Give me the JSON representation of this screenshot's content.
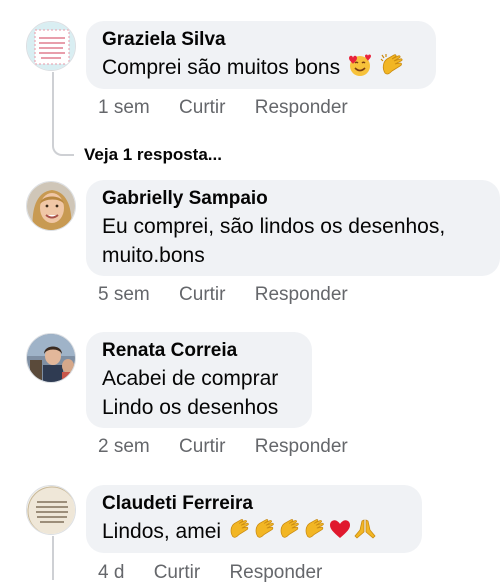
{
  "comments": [
    {
      "author": "Graziela Silva",
      "lines": [
        "Comprei são muitos bons"
      ],
      "emojis": [
        "smiling-face-with-hearts",
        "clapping-hands"
      ],
      "time": "1 sem",
      "like": "Curtir",
      "reply": "Responder"
    },
    {
      "author": "Gabrielly Sampaio",
      "lines": [
        "Eu comprei, são lindos os desenhos,",
        "muito.bons"
      ],
      "time": "5 sem",
      "like": "Curtir",
      "reply": "Responder"
    },
    {
      "author": "Renata Correia",
      "lines": [
        "Acabei de comprar",
        "Lindo os desenhos"
      ],
      "time": "2 sem",
      "like": "Curtir",
      "reply": "Responder"
    },
    {
      "author": "Claudeti Ferreira",
      "lines": [
        "Lindos, amei"
      ],
      "emojis": [
        "clapping-hands",
        "clapping-hands",
        "clapping-hands",
        "clapping-hands",
        "red-heart",
        "folded-hands"
      ],
      "time": "4 d",
      "like": "Curtir",
      "reply": "Responder"
    }
  ],
  "see_replies": "Veja 1 resposta...",
  "colors": {
    "bubble": "#f0f2f5",
    "meta": "#65676b",
    "text": "#050505",
    "thread": "#ced0d4"
  }
}
